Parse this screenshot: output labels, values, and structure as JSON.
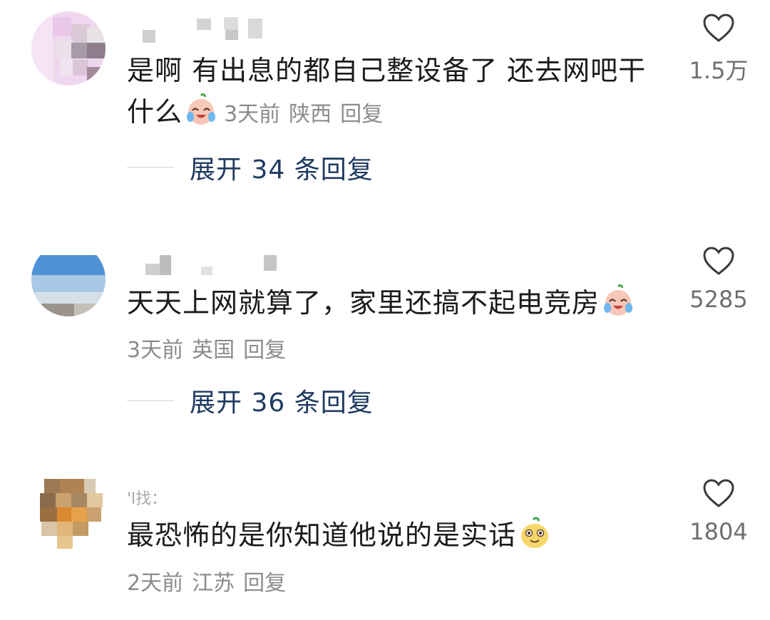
{
  "comments": [
    {
      "username": "",
      "text": "是啊 有出息的都自己整设备了 还去网吧干什么",
      "text_line1": "是啊 有出息的都自己整设备了 还去网吧干",
      "text_line2": "什么",
      "emoji": "crying-laughing-face-icon",
      "time": "3天前",
      "location": "陕西",
      "reply": "回复",
      "expand": "展开 34 条回复",
      "likes": "1.5万"
    },
    {
      "username": "",
      "text": "天天上网就算了，家里还搞不起电竞房",
      "emoji": "crying-laughing-face-icon",
      "time": "3天前",
      "location": "英国",
      "reply": "回复",
      "expand": "展开 36 条回复",
      "likes": "5285"
    },
    {
      "username": "'l找：",
      "text": "最恐怖的是你知道他说的是实话",
      "emoji": "cheeky-face-icon",
      "time": "2天前",
      "location": "江苏",
      "reply": "回复",
      "likes": "1804"
    }
  ],
  "colors": {
    "text": "#1b1b1b",
    "meta": "#8c8c8c",
    "expand": "#1f3a60",
    "count": "#6f6f6f"
  }
}
